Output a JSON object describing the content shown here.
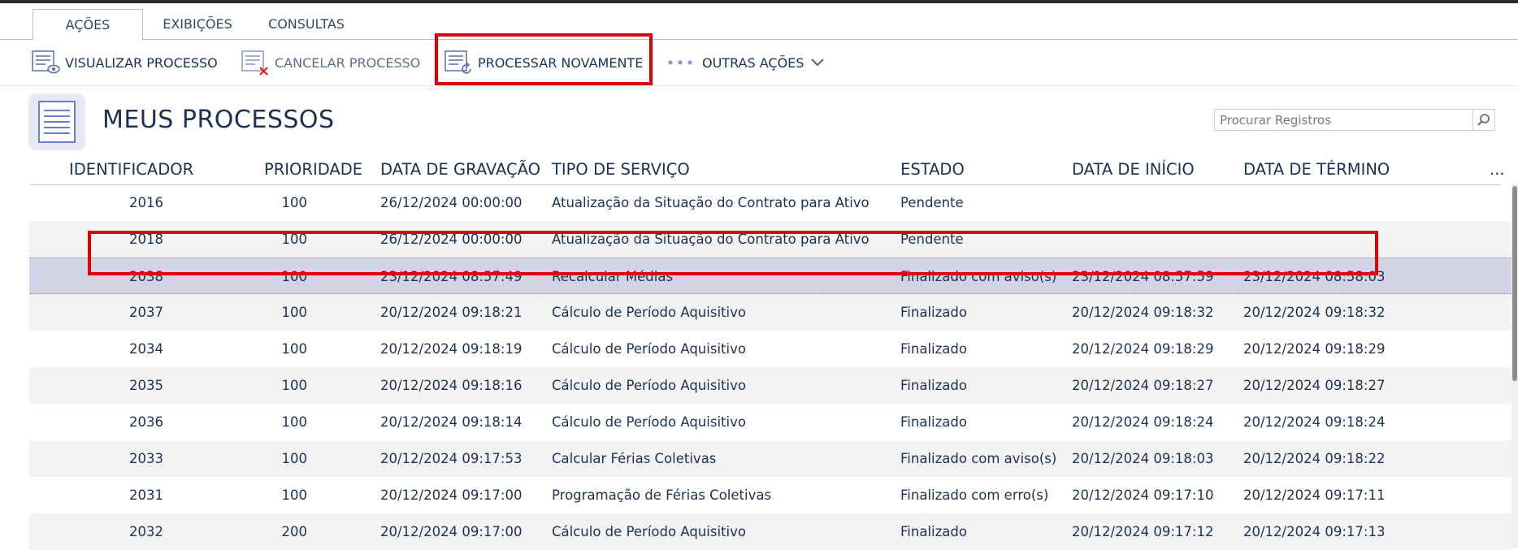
{
  "tabs": [
    {
      "label": "AÇÕES",
      "active": true
    },
    {
      "label": "EXIBIÇÕES",
      "active": false
    },
    {
      "label": "CONSULTAS",
      "active": false
    }
  ],
  "toolbar": {
    "view_label": "VISUALIZAR PROCESSO",
    "cancel_label": "CANCELAR PROCESSO",
    "reprocess_label": "PROCESSAR NOVAMENTE",
    "more_label": "OUTRAS AÇÕES"
  },
  "page": {
    "title": "MEUS PROCESSOS",
    "search_placeholder": "Procurar Registros"
  },
  "table": {
    "columns": [
      "IDENTIFICADOR",
      "PRIORIDADE",
      "DATA DE GRAVAÇÃO",
      "TIPO DE SERVIÇO",
      "ESTADO",
      "DATA DE INÍCIO",
      "DATA DE TÉRMINO",
      "..."
    ],
    "rows": [
      {
        "id": "2016",
        "priority": "100",
        "recorded": "26/12/2024 00:00:00",
        "service": "Atualização da Situação do Contrato para Ativo",
        "status": "Pendente",
        "start": "",
        "end": ""
      },
      {
        "id": "2018",
        "priority": "100",
        "recorded": "26/12/2024 00:00:00",
        "service": "Atualização da Situação do Contrato para Ativo",
        "status": "Pendente",
        "start": "",
        "end": ""
      },
      {
        "id": "2038",
        "priority": "100",
        "recorded": "23/12/2024 08:57:49",
        "service": "Recalcular Médias",
        "status": "Finalizado com aviso(s)",
        "start": "23/12/2024 08:57:59",
        "end": "23/12/2024 08:58:03",
        "selected": true
      },
      {
        "id": "2037",
        "priority": "100",
        "recorded": "20/12/2024 09:18:21",
        "service": "Cálculo de Período Aquisitivo",
        "status": "Finalizado",
        "start": "20/12/2024 09:18:32",
        "end": "20/12/2024 09:18:32"
      },
      {
        "id": "2034",
        "priority": "100",
        "recorded": "20/12/2024 09:18:19",
        "service": "Cálculo de Período Aquisitivo",
        "status": "Finalizado",
        "start": "20/12/2024 09:18:29",
        "end": "20/12/2024 09:18:29"
      },
      {
        "id": "2035",
        "priority": "100",
        "recorded": "20/12/2024 09:18:16",
        "service": "Cálculo de Período Aquisitivo",
        "status": "Finalizado",
        "start": "20/12/2024 09:18:27",
        "end": "20/12/2024 09:18:27"
      },
      {
        "id": "2036",
        "priority": "100",
        "recorded": "20/12/2024 09:18:14",
        "service": "Cálculo de Período Aquisitivo",
        "status": "Finalizado",
        "start": "20/12/2024 09:18:24",
        "end": "20/12/2024 09:18:24"
      },
      {
        "id": "2033",
        "priority": "100",
        "recorded": "20/12/2024 09:17:53",
        "service": "Calcular Férias Coletivas",
        "status": "Finalizado com aviso(s)",
        "start": "20/12/2024 09:18:03",
        "end": "20/12/2024 09:18:22"
      },
      {
        "id": "2031",
        "priority": "100",
        "recorded": "20/12/2024 09:17:00",
        "service": "Programação de Férias Coletivas",
        "status": "Finalizado com erro(s)",
        "start": "20/12/2024 09:17:10",
        "end": "20/12/2024 09:17:11"
      },
      {
        "id": "2032",
        "priority": "200",
        "recorded": "20/12/2024 09:17:00",
        "service": "Cálculo de Período Aquisitivo",
        "status": "Finalizado",
        "start": "20/12/2024 09:17:12",
        "end": "20/12/2024 09:17:13"
      }
    ]
  },
  "colors": {
    "highlight": "#e00000",
    "selected_row": "#d2d4e6",
    "alt_row": "#f3f3f3"
  }
}
